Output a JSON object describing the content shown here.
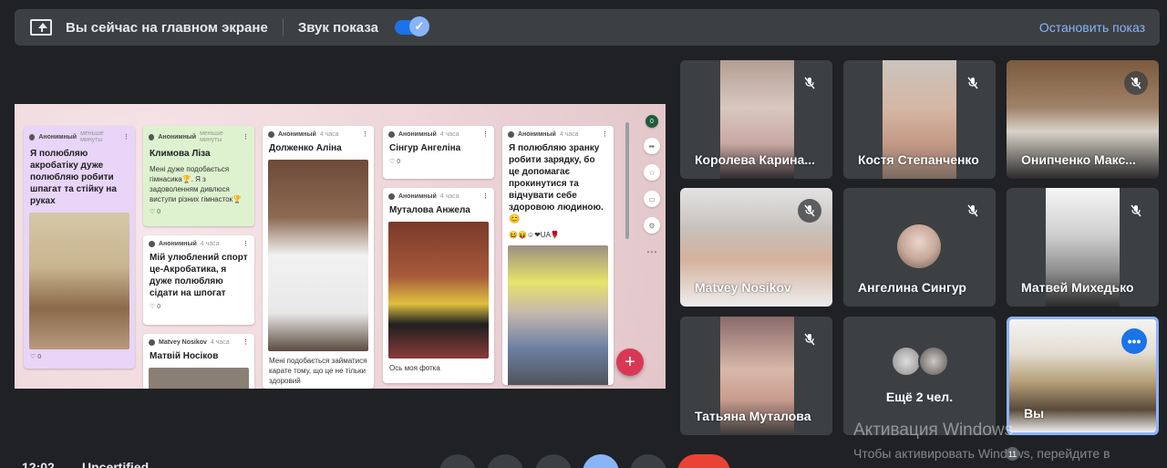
{
  "banner": {
    "main_text": "Вы сейчас на главном экране",
    "sound_label": "Звук показа",
    "sound_on": true,
    "stop_link": "Остановить показ"
  },
  "presentation": {
    "notification_count": "0",
    "cards": [
      {
        "author": "Анонимный",
        "time": "меньше минуты",
        "title": "",
        "body": "Я полюбляю акробатіку дуже полюбляю робити шпагат та стійку на руках",
        "likes": "0"
      },
      {
        "author": "Анонимный",
        "time": "меньше минуты",
        "title": "Климова Ліза",
        "body": "Мені дуже подобається гімнасика🏆. Я з задоволенням дивлюся виступи різних гімнасток🏆",
        "likes": "0"
      },
      {
        "author": "Анонимный",
        "time": "4 часа",
        "title": "Мій улюблений спорт це-Акробатика, я дуже полюбляю сідати на шпогат",
        "body": "",
        "likes": "0"
      },
      {
        "author": "Matvey Nosikov",
        "time": "4 часа",
        "title": "Матвій Носіков",
        "body": "",
        "likes": ""
      },
      {
        "author": "Анонимный",
        "time": "4 часа",
        "title": "Долженко Аліна",
        "body": "Мені подобається займатися карате тому, що це не тільки здоровий",
        "likes": ""
      },
      {
        "author": "Анонимный",
        "time": "4 часа",
        "title": "Сінгур Ангеліна",
        "body": "",
        "likes": "0"
      },
      {
        "author": "Анонимный",
        "time": "4 часа",
        "title": "Муталова Анжела",
        "body": "Ось моя фотка",
        "likes": ""
      },
      {
        "author": "Анонимный",
        "time": "4 часа",
        "title": "Я полюбляю зранку робити зарядку, бо це допомагає прокинутися та відчувати себе здоровою людиною.😊",
        "body": "😆😝☺❤UA🌹",
        "likes": ""
      }
    ]
  },
  "participants": [
    {
      "name": "Королева Карина...",
      "muted": true
    },
    {
      "name": "Костя Степанченко",
      "muted": true
    },
    {
      "name": "Онипченко Макс...",
      "muted": true
    },
    {
      "name": "Matvey Nosikov",
      "muted": true
    },
    {
      "name": "Ангелина Сингур",
      "muted": true
    },
    {
      "name": "Матвей Михедько",
      "muted": true
    },
    {
      "name": "Татьяна Муталова",
      "muted": true
    },
    {
      "name": "Ещё 2 чел.",
      "muted": false
    },
    {
      "name": "Вы",
      "muted": false
    }
  ],
  "more_options_label": "•••",
  "watermark": {
    "title": "Активация Windows",
    "subtitle": "Чтобы активировать Windows, перейдите в"
  },
  "bottom": {
    "clock": "12:02",
    "meeting_id": "Uncertified",
    "participants_count": "11"
  },
  "colors": {
    "background": "#202124",
    "tile": "#3c4043",
    "accent": "#8ab4f8",
    "end_call": "#ea4335",
    "fab": "#d93854"
  }
}
